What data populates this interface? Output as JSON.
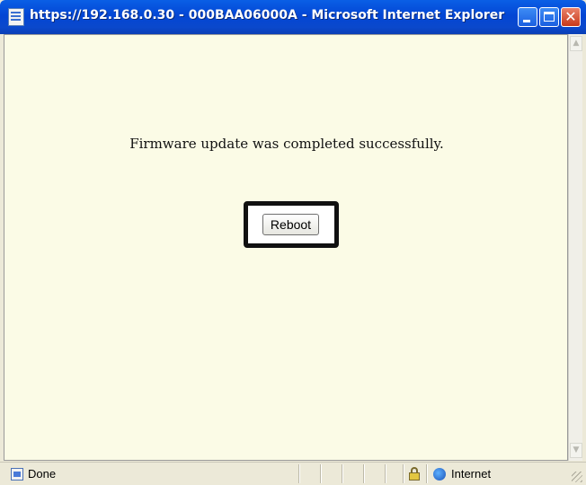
{
  "window": {
    "title": "https://192.168.0.30 - 000BAA06000A - Microsoft Internet Explorer",
    "icon": "ie-page-icon"
  },
  "page": {
    "message": "Firmware update was completed successfully.",
    "reboot_label": "Reboot"
  },
  "status": {
    "text": "Done",
    "zone": "Internet"
  },
  "colors": {
    "titlebar": "#0a5fe6",
    "content_bg": "#fbfbe6",
    "highlight_border": "#111111"
  }
}
